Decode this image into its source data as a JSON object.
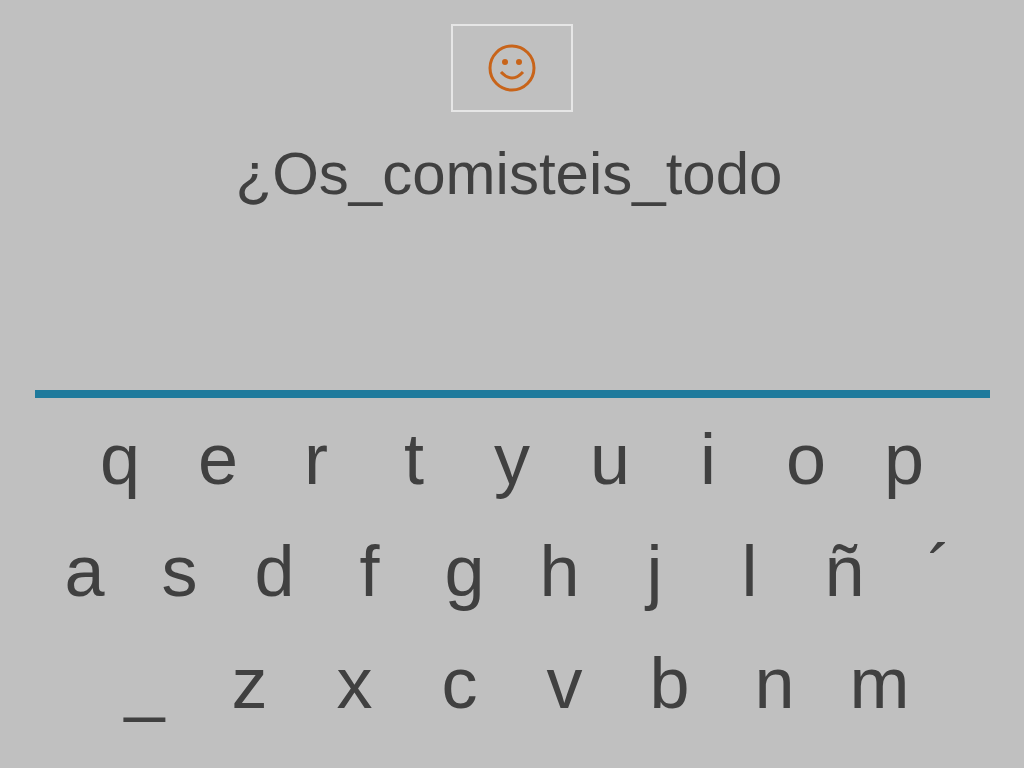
{
  "prompt": "¿Os_comisteis_todo",
  "keyboard": {
    "rows": [
      [
        "q",
        "e",
        "r",
        "t",
        "y",
        "u",
        "i",
        "o",
        "p"
      ],
      [
        "a",
        "s",
        "d",
        "f",
        "g",
        "h",
        "j",
        "l",
        "ñ",
        "´"
      ],
      [
        "_",
        "z",
        "x",
        "c",
        "v",
        "b",
        "n",
        "m"
      ]
    ]
  }
}
